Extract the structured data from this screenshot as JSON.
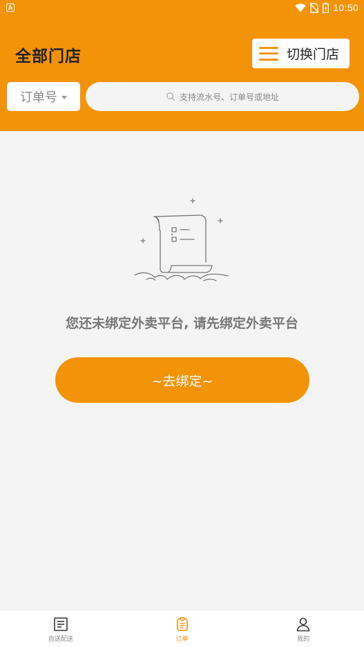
{
  "status_bar": {
    "app_icon_letter": "A",
    "time": "10:50"
  },
  "header": {
    "title": "全部门店",
    "switch_store_label": "切换门店"
  },
  "search": {
    "type_label": "订单号",
    "placeholder": "支持流水号、订单号或地址"
  },
  "empty_state": {
    "message": "您还未绑定外卖平台, 请先绑定外卖平台",
    "bind_button_label": "~去绑定~"
  },
  "bottom_nav": {
    "items": [
      {
        "label": "自送配送",
        "icon": "document-icon",
        "active": false
      },
      {
        "label": "订单",
        "icon": "clipboard-icon",
        "active": true
      },
      {
        "label": "我的",
        "icon": "person-icon",
        "active": false
      }
    ]
  },
  "colors": {
    "accent": "#f39307",
    "background": "#f4f4f4"
  }
}
